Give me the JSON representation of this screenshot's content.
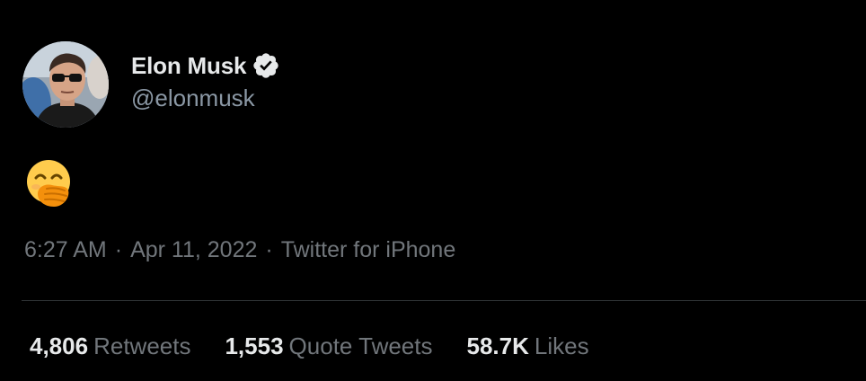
{
  "user": {
    "display_name": "Elon Musk",
    "handle": "@elonmusk",
    "verified": true
  },
  "tweet": {
    "content_emoji": "face-with-hand-over-mouth",
    "time": "6:27 AM",
    "date": "Apr 11, 2022",
    "source": "Twitter for iPhone",
    "separator": "·"
  },
  "stats": {
    "retweets": {
      "count": "4,806",
      "label": "Retweets"
    },
    "quote_tweets": {
      "count": "1,553",
      "label": "Quote Tweets"
    },
    "likes": {
      "count": "58.7K",
      "label": "Likes"
    }
  },
  "colors": {
    "background": "#000000",
    "primary_text": "#e7e9ea",
    "secondary_text": "#71767b",
    "divider": "#2f3336"
  },
  "icons": {
    "verified": "verified-badge-icon",
    "avatar": "profile-photo"
  }
}
